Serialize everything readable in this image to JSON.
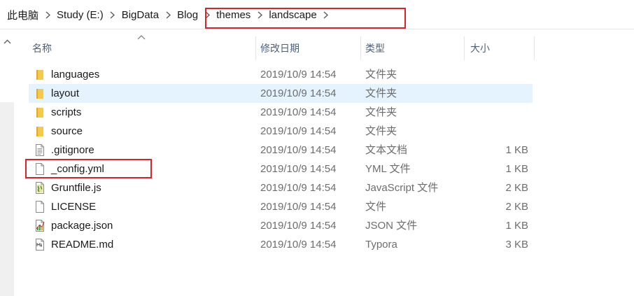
{
  "breadcrumb": {
    "items": [
      "此电脑",
      "Study (E:)",
      "BigData",
      "Blog",
      "themes",
      "landscape"
    ]
  },
  "columns": {
    "name": "名称",
    "modified": "修改日期",
    "type": "类型",
    "size": "大小"
  },
  "files": [
    {
      "name": "languages",
      "modified": "2019/10/9 14:54",
      "type": "文件夹",
      "size": "",
      "icon": "folder-icon",
      "selected": false
    },
    {
      "name": "layout",
      "modified": "2019/10/9 14:54",
      "type": "文件夹",
      "size": "",
      "icon": "folder-icon",
      "selected": true
    },
    {
      "name": "scripts",
      "modified": "2019/10/9 14:54",
      "type": "文件夹",
      "size": "",
      "icon": "folder-icon",
      "selected": false
    },
    {
      "name": "source",
      "modified": "2019/10/9 14:54",
      "type": "文件夹",
      "size": "",
      "icon": "folder-icon",
      "selected": false
    },
    {
      "name": ".gitignore",
      "modified": "2019/10/9 14:54",
      "type": "文本文档",
      "size": "1 KB",
      "icon": "text-document-icon",
      "selected": false
    },
    {
      "name": "_config.yml",
      "modified": "2019/10/9 14:54",
      "type": "YML 文件",
      "size": "1 KB",
      "icon": "blank-file-icon",
      "selected": false
    },
    {
      "name": "Gruntfile.js",
      "modified": "2019/10/9 14:54",
      "type": "JavaScript 文件",
      "size": "2 KB",
      "icon": "javascript-file-icon",
      "selected": false
    },
    {
      "name": "LICENSE",
      "modified": "2019/10/9 14:54",
      "type": "文件",
      "size": "2 KB",
      "icon": "blank-file-icon",
      "selected": false
    },
    {
      "name": "package.json",
      "modified": "2019/10/9 14:54",
      "type": "JSON 文件",
      "size": "1 KB",
      "icon": "json-file-icon",
      "selected": false
    },
    {
      "name": "README.md",
      "modified": "2019/10/9 14:54",
      "type": "Typora",
      "size": "3 KB",
      "icon": "markdown-file-icon",
      "selected": false
    }
  ],
  "colors": {
    "highlight_border": "#d9232b",
    "selection_bg": "#e5f3ff",
    "header_text": "#4c607a",
    "folder_yellow": "#f7c948"
  }
}
